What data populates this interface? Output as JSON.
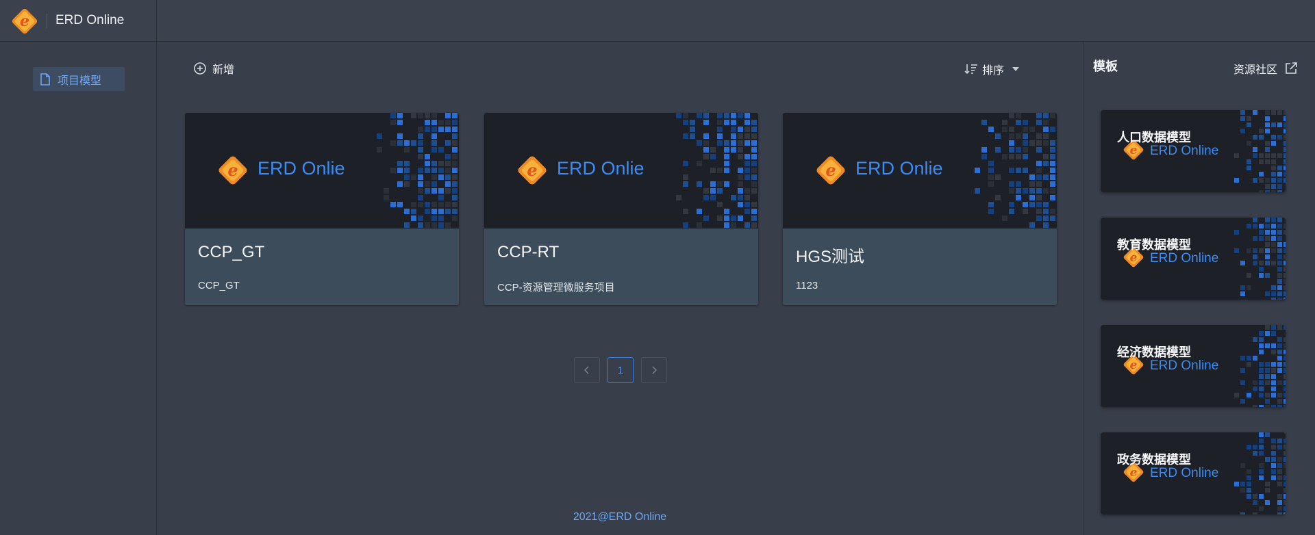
{
  "header": {
    "app_name": "ERD Online"
  },
  "sidebar": {
    "items": [
      {
        "label": "项目模型",
        "icon": "file-icon"
      }
    ]
  },
  "toolbar": {
    "add_label": "新增",
    "sort_label": "排序"
  },
  "cards": [
    {
      "name": "CCP_GT",
      "description": "CCP_GT",
      "banner_text": "ERD Onlie"
    },
    {
      "name": "CCP-RT",
      "description": "CCP-资源管理微服务项目",
      "banner_text": "ERD Onlie"
    },
    {
      "name": "HGS测试",
      "description": "1123",
      "banner_text": "ERD Onlie"
    }
  ],
  "pagination": {
    "prev": "<",
    "current": "1",
    "next": ">"
  },
  "footer": {
    "text": "2021@ERD Online"
  },
  "templates": {
    "title": "模板",
    "community_link": "资源社区",
    "items": [
      {
        "name": "人口数据模型",
        "logo_text": "ERD Online"
      },
      {
        "name": "教育数据模型",
        "logo_text": "ERD Online"
      },
      {
        "name": "经济数据模型",
        "logo_text": "ERD Online"
      },
      {
        "name": "政务数据模型",
        "logo_text": "ERD Online"
      }
    ]
  },
  "colors": {
    "background": "#383e4a",
    "card_body": "#3c4c5b",
    "banner": "#1d2026",
    "accent": "#4e93f2",
    "logo_orange": "#f08a24"
  }
}
